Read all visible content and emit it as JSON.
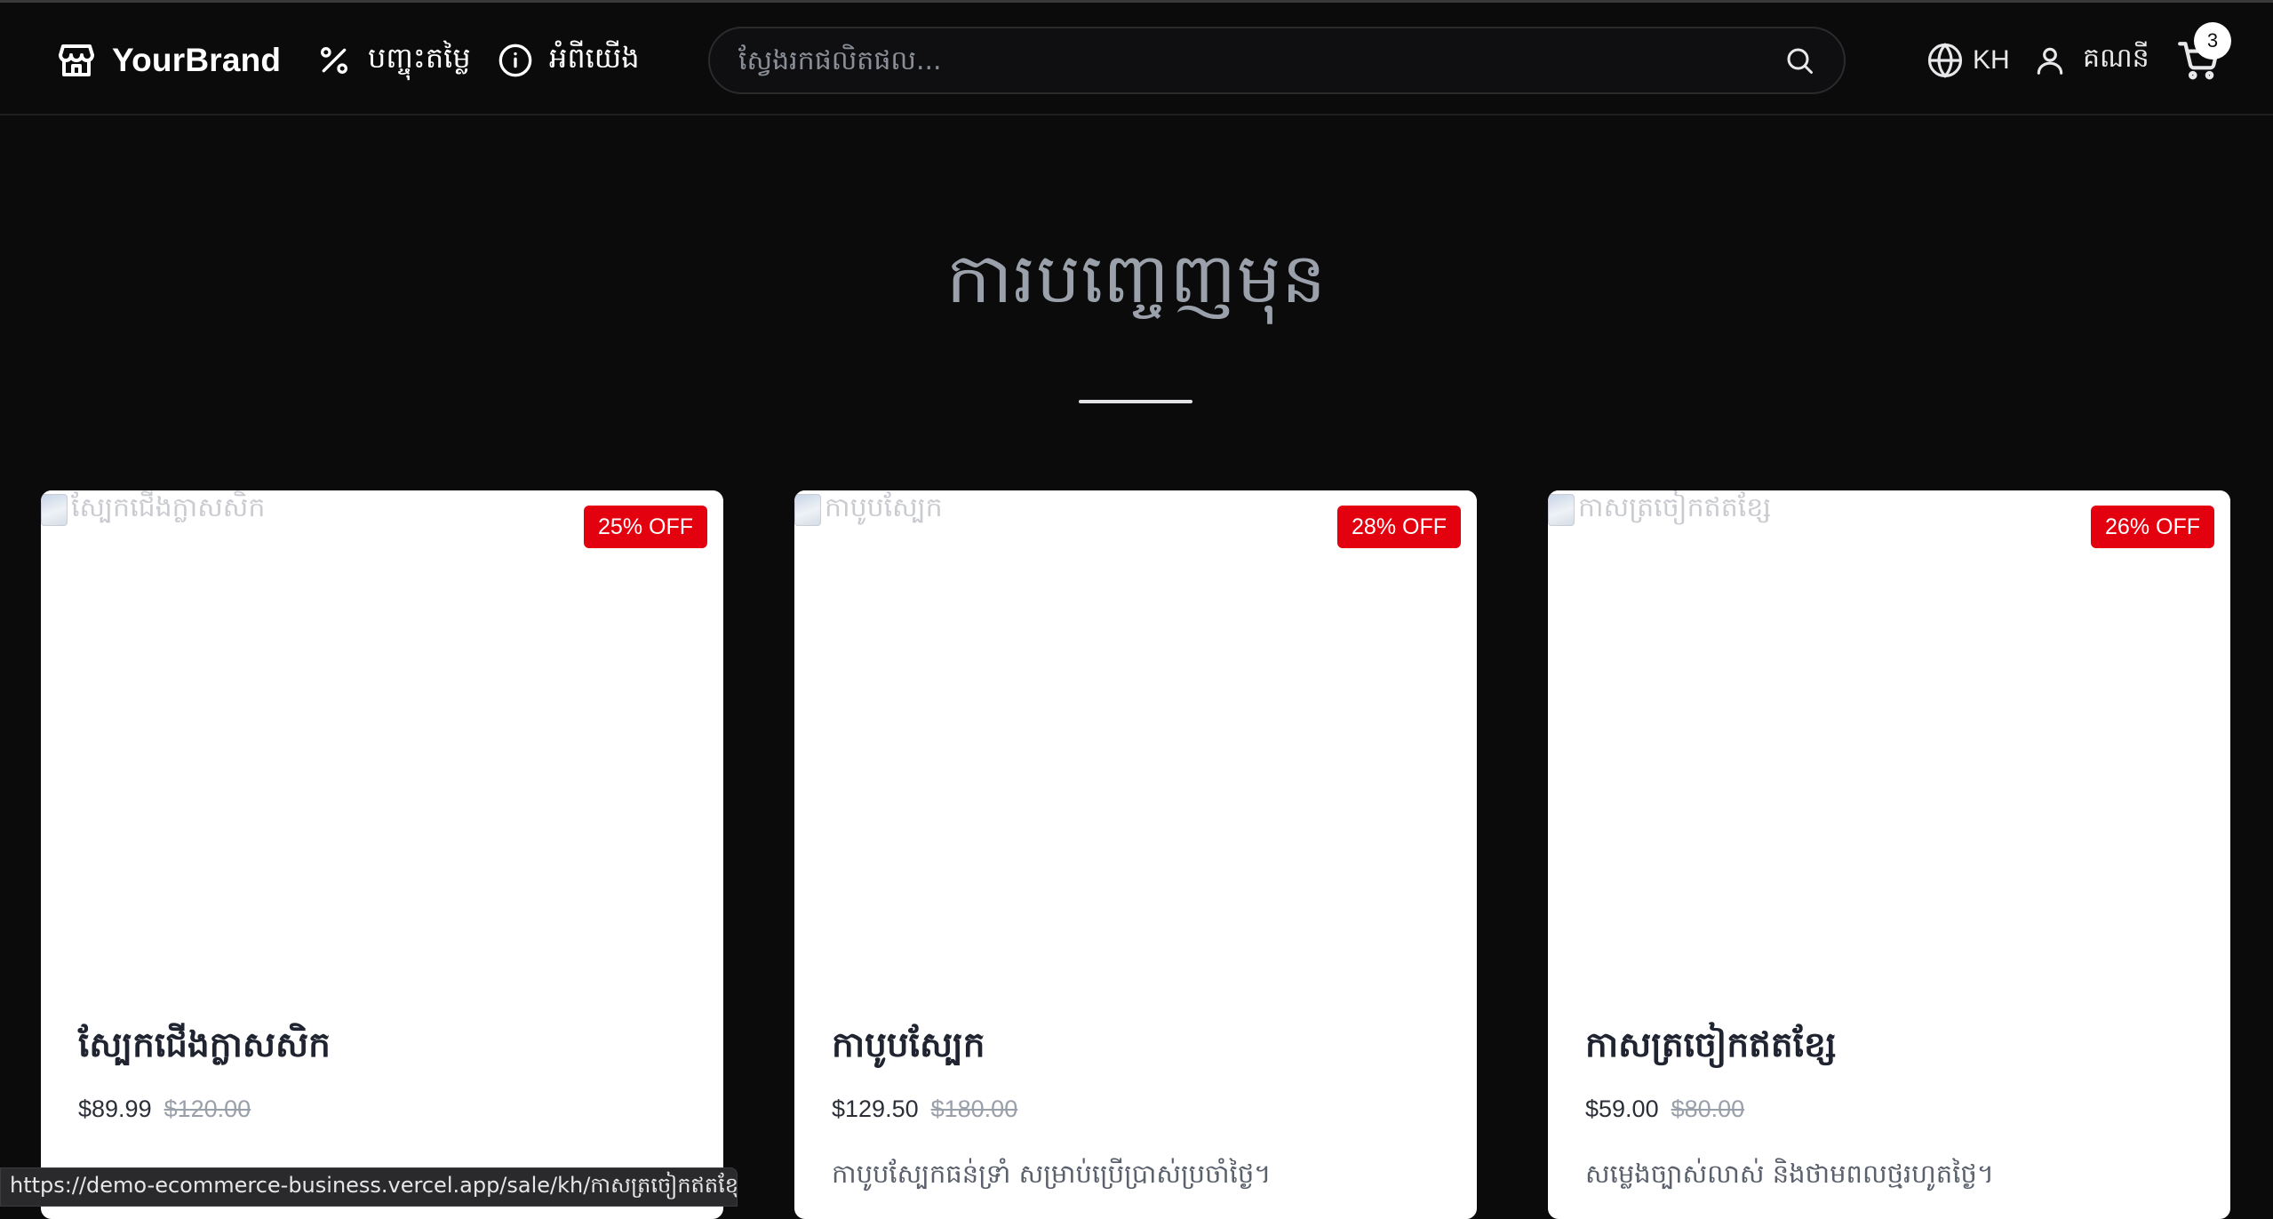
{
  "header": {
    "brand": "YourBrand",
    "nav": {
      "sale_label": "បញ្ចុះតម្លៃ",
      "about_label": "អំពីយើង"
    },
    "search": {
      "placeholder": "ស្វែងរកផលិតផល...",
      "value": ""
    },
    "language": "KH",
    "account_label": "គណនី",
    "cart_count": "3"
  },
  "hero": {
    "title": "ការបញ្ចេញមុន"
  },
  "products": [
    {
      "image_alt": "ស្បែកជើងក្លាសសិក",
      "discount": "25% OFF",
      "name": "ស្បែកជើងក្លាសសិក",
      "price": "$89.99",
      "old_price": "$120.00",
      "description": ""
    },
    {
      "image_alt": "កាបូបស្បែក",
      "discount": "28% OFF",
      "name": "កាបូបស្បែក",
      "price": "$129.50",
      "old_price": "$180.00",
      "description": "កាបូបស្បែកធន់ទ្រាំ សម្រាប់ប្រើប្រាស់ប្រចាំថ្ងៃ។"
    },
    {
      "image_alt": "កាសត្រចៀកឥតខ្សែ",
      "discount": "26% OFF",
      "name": "កាសត្រចៀកឥតខ្សែ",
      "price": "$59.00",
      "old_price": "$80.00",
      "description": "សម្លេងច្បាស់លាស់ និងថាមពលថ្មរហូតថ្ងៃ។"
    }
  ],
  "status_bar": {
    "url": "https://demo-ecommerce-business.vercel.app/sale/kh/កាសត្រចៀកឥតខ្សែរ"
  },
  "colors": {
    "background": "#0b0b0c",
    "badge": "#e3000f",
    "card": "#ffffff"
  }
}
